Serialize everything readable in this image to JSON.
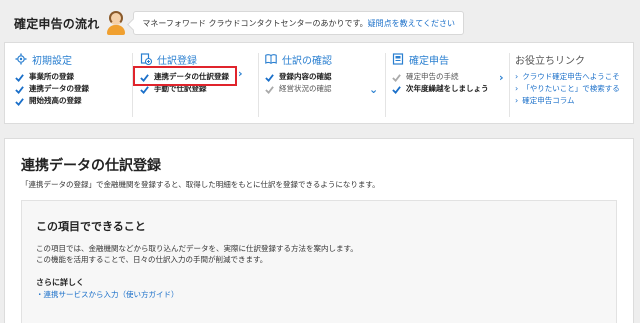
{
  "header": {
    "title": "確定申告の流れ",
    "bubble_text": "マネーフォワード クラウドコンタクトセンターのあかりです。",
    "bubble_link": "疑問点を教えてください"
  },
  "steps": [
    {
      "title": "初期設定",
      "icon": "gear-icon",
      "items": [
        {
          "label": "事業所の登録"
        },
        {
          "label": "連携データの登録"
        },
        {
          "label": "開始残高の登録"
        }
      ]
    },
    {
      "title": "仕訳登録",
      "icon": "document-plus-icon",
      "items": [
        {
          "label": "連携データの仕訳登録"
        },
        {
          "label": "手動で仕訳登録"
        }
      ]
    },
    {
      "title": "仕訳の確認",
      "icon": "book-icon",
      "items": [
        {
          "label": "登録内容の確認"
        },
        {
          "label": "経営状況の確認"
        }
      ]
    },
    {
      "title": "確定申告",
      "icon": "report-icon",
      "items": [
        {
          "label": "確定申告の手続"
        },
        {
          "label": "次年度繰越をしましょう"
        }
      ]
    }
  ],
  "help_links": {
    "title": "お役立ちリンク",
    "items": [
      {
        "label": "クラウド確定申告へようこそ"
      },
      {
        "label": "「やりたいこと」で検索する"
      },
      {
        "label": "確定申告コラム"
      }
    ]
  },
  "main": {
    "title": "連携データの仕訳登録",
    "description": "「連携データの登録」で金融機関を登録すると、取得した明細をもとに仕訳を登録できるようになります。",
    "card": {
      "title": "この項目でできること",
      "line1": "この項目では、金融機関などから取り込んだデータを、実際に仕訳登録する方法を案内します。",
      "line2": "この機能を活用することで、日々の仕訳入力の手間が削減できます。",
      "more_title": "さらに詳しく",
      "guide_link": "・連携サービスから入力（使い方ガイド）"
    }
  },
  "colors": {
    "accent": "#2a7fd0",
    "check_blue": "#1a6fc9",
    "check_grey": "#aaaaaa",
    "highlight": "#e0242c"
  }
}
